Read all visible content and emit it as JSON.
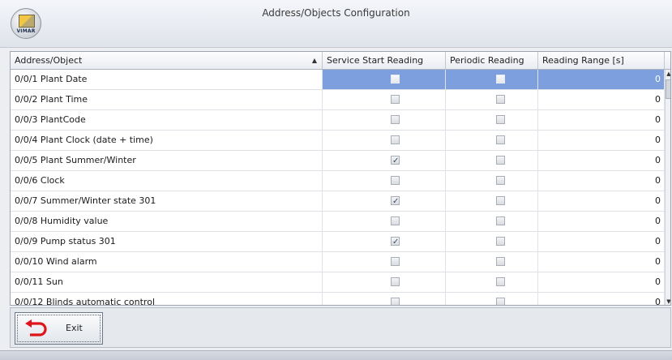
{
  "window": {
    "title": "Address/Objects Configuration",
    "logo_text": "VIMAR"
  },
  "grid": {
    "columns": [
      "Address/Object",
      "Service Start Reading",
      "Periodic Reading",
      "Reading Range [s]"
    ],
    "sort_column": "Address/Object",
    "sort_direction": "ascending",
    "rows": [
      {
        "address": "0/0/1 Plant Date",
        "service_start": false,
        "periodic": false,
        "range": "0",
        "selected": true
      },
      {
        "address": "0/0/2 Plant Time",
        "service_start": false,
        "periodic": false,
        "range": "0"
      },
      {
        "address": "0/0/3 PlantCode",
        "service_start": false,
        "periodic": false,
        "range": "0"
      },
      {
        "address": "0/0/4 Plant Clock (date + time)",
        "service_start": false,
        "periodic": false,
        "range": "0"
      },
      {
        "address": "0/0/5 Plant Summer/Winter",
        "service_start": true,
        "periodic": false,
        "range": "0"
      },
      {
        "address": "0/0/6 Clock",
        "service_start": false,
        "periodic": false,
        "range": "0"
      },
      {
        "address": "0/0/7 Summer/Winter state 301",
        "service_start": true,
        "periodic": false,
        "range": "0"
      },
      {
        "address": "0/0/8 Humidity value",
        "service_start": false,
        "periodic": false,
        "range": "0"
      },
      {
        "address": "0/0/9 Pump status 301",
        "service_start": true,
        "periodic": false,
        "range": "0"
      },
      {
        "address": "0/0/10 Wind alarm",
        "service_start": false,
        "periodic": false,
        "range": "0"
      },
      {
        "address": "0/0/11 Sun",
        "service_start": false,
        "periodic": false,
        "range": "0"
      },
      {
        "address": "0/0/12 Blinds automatic control",
        "service_start": false,
        "periodic": false,
        "range": "0"
      }
    ]
  },
  "footer": {
    "exit_label": "Exit"
  },
  "colors": {
    "selection": "#7d9fde",
    "exit_arrow": "#e0151c"
  }
}
